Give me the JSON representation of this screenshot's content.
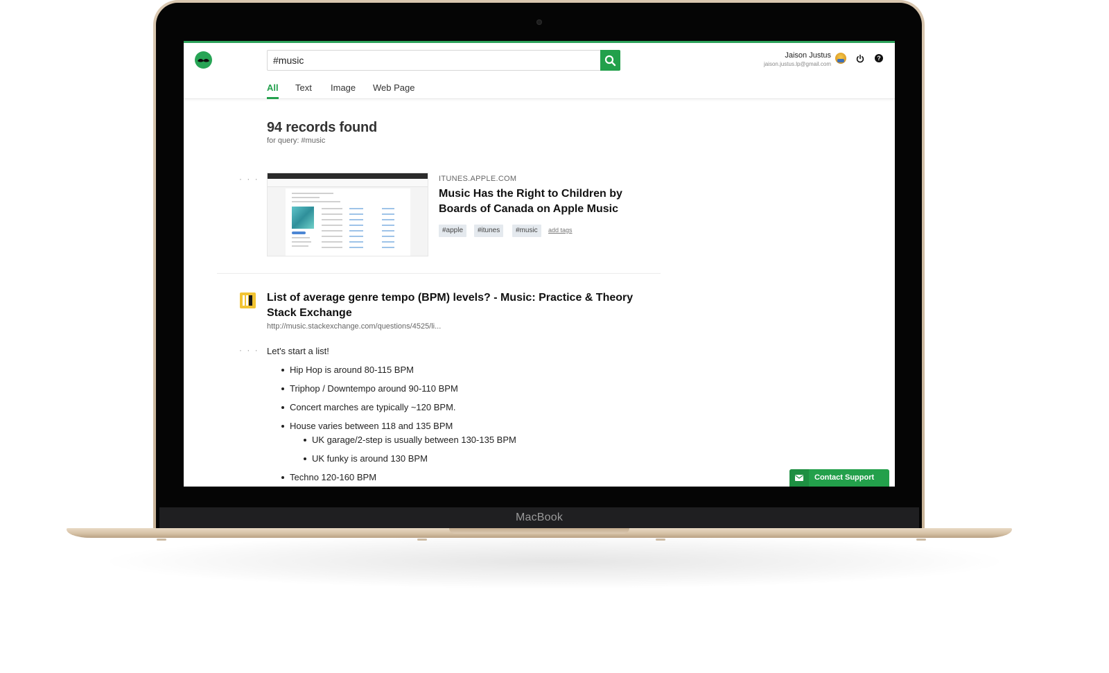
{
  "device": {
    "brand": "MacBook"
  },
  "header": {
    "search": {
      "value": "#music"
    },
    "user": {
      "name": "Jaison Justus",
      "email": "jaison.justus.lp@gmail.com"
    },
    "help_label": "?"
  },
  "tabs": [
    {
      "label": "All",
      "active": true
    },
    {
      "label": "Text",
      "active": false
    },
    {
      "label": "Image",
      "active": false
    },
    {
      "label": "Web Page",
      "active": false
    }
  ],
  "summary": {
    "title": "94 records found",
    "query_prefix": "for query:",
    "query": "#music"
  },
  "results": [
    {
      "more_label": "· · ·",
      "domain": "ITUNES.APPLE.COM",
      "title": "Music Has the Right to Children by Boards of Canada on Apple Music",
      "tags": [
        "#apple",
        "#itunes",
        "#music"
      ],
      "add_tags_label": "add tags"
    },
    {
      "more_label": "· · ·",
      "title": "List of average genre tempo (BPM) levels? - Music: Practice & Theory Stack Exchange",
      "url": "http://music.stackexchange.com/questions/4525/li...",
      "intro": "Let's start a list!",
      "items": [
        "Hip Hop is around 80-115 BPM",
        "Triphop / Downtempo around 90-110 BPM",
        "Concert marches are typically ~120 BPM.",
        "House varies between 118 and 135 BPM",
        "UK garage/2-step is usually between 130-135 BPM",
        "UK funky is around 130 BPM",
        "Techno 120-160 BPM"
      ]
    }
  ],
  "support": {
    "label": "Contact Support"
  },
  "colors": {
    "accent": "#23a04b",
    "tag_bg": "#e4e9ee",
    "stack_icon": "#f2c433"
  }
}
